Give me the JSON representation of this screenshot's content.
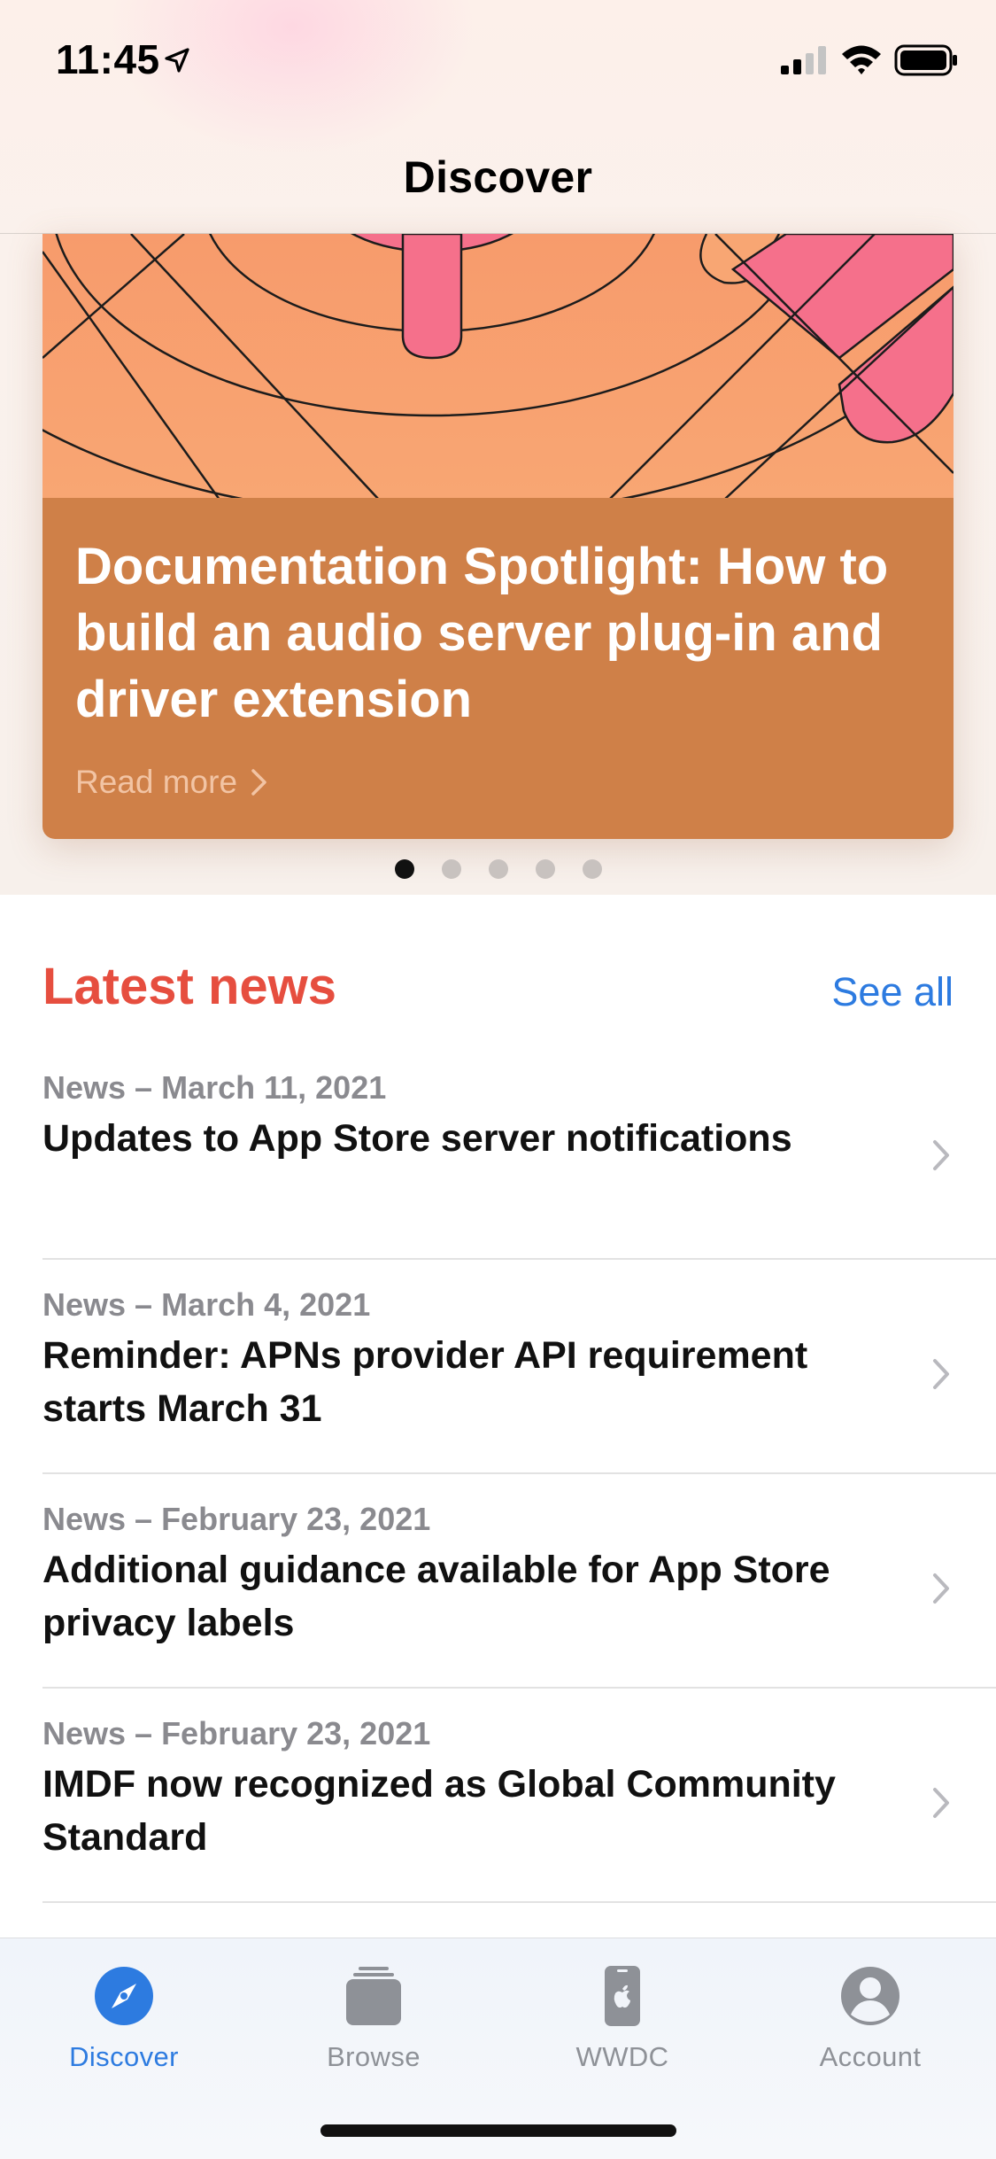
{
  "status_bar": {
    "time": "11:45"
  },
  "nav": {
    "title": "Discover"
  },
  "hero": {
    "title": "Documentation Spotlight: How to build an audio server plug-in and driver extension",
    "read_more": "Read more",
    "pages": 5,
    "active_page": 1
  },
  "news": {
    "heading": "Latest news",
    "see_all": "See all",
    "items": [
      {
        "meta": "News – March 11, 2021",
        "title": "Updates to App Store server notifications"
      },
      {
        "meta": "News – March 4, 2021",
        "title": "Reminder: APNs provider API requirement starts March 31"
      },
      {
        "meta": "News – February 23, 2021",
        "title": "Additional guidance available for App Store privacy labels"
      },
      {
        "meta": "News – February 23, 2021",
        "title": "IMDF now recognized as Global Community Standard"
      }
    ]
  },
  "tabs": [
    {
      "label": "Discover",
      "icon": "compass-icon",
      "active": true
    },
    {
      "label": "Browse",
      "icon": "stack-icon",
      "active": false
    },
    {
      "label": "WWDC",
      "icon": "wwdc-phone-icon",
      "active": false
    },
    {
      "label": "Account",
      "icon": "person-icon",
      "active": false
    }
  ],
  "colors": {
    "accent_red": "#e64e3f",
    "link_blue": "#2d7be0",
    "hero_card": "#cf8048",
    "tab_active": "#2d7be0",
    "tab_inactive": "#8e9197"
  }
}
